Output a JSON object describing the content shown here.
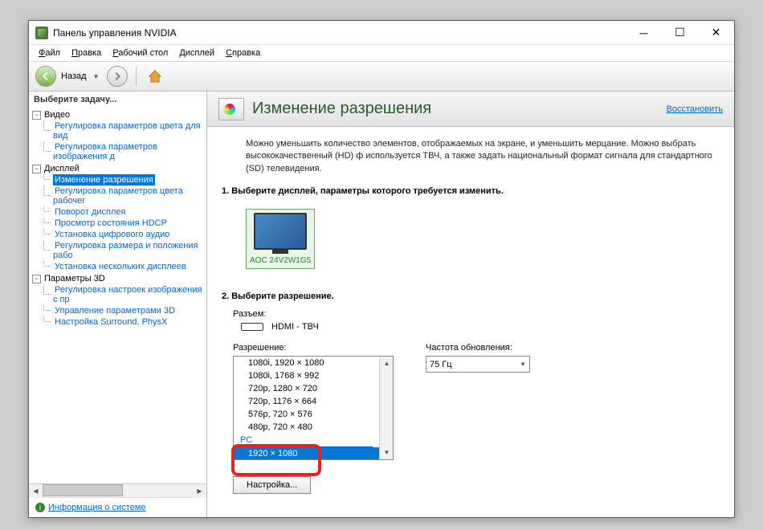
{
  "window": {
    "title": "Панель управления NVIDIA"
  },
  "menu": {
    "file": "Файл",
    "edit": "Правка",
    "desktop": "Рабочий стол",
    "display": "Дисплей",
    "help": "Справка"
  },
  "toolbar": {
    "back": "Назад"
  },
  "sidebar": {
    "task_label": "Выберите задачу...",
    "groups": [
      {
        "label": "Видео",
        "items": [
          {
            "label": "Регулировка параметров цвета для вид"
          },
          {
            "label": "Регулировка параметров изображения д"
          }
        ]
      },
      {
        "label": "Дисплей",
        "items": [
          {
            "label": "Изменение разрешения",
            "selected": true
          },
          {
            "label": "Регулировка параметров цвета рабочег"
          },
          {
            "label": "Поворот дисплея"
          },
          {
            "label": "Просмотр состояния HDCP"
          },
          {
            "label": "Установка цифрового аудио"
          },
          {
            "label": "Регулировка размера и положения рабо"
          },
          {
            "label": "Установка нескольких дисплеев"
          }
        ]
      },
      {
        "label": "Параметры 3D",
        "items": [
          {
            "label": "Регулировка настроек изображения с пр"
          },
          {
            "label": "Управление параметрами 3D"
          },
          {
            "label": "Настройка Surround, PhysX"
          }
        ]
      }
    ],
    "sysinfo": "Информация о системе"
  },
  "content": {
    "title": "Изменение разрешения",
    "restore": "Восстановить",
    "description": "Можно уменьшить количество элементов, отображаемых на экране, и уменьшить мерцание. Можно выбрать высококачественный (HD) ф используется ТВЧ, а также задать национальный формат сигнала для стандартного (SD) телевидения.",
    "step1": "1. Выберите дисплей, параметры которого требуется изменить.",
    "monitor": "AOC 24V2W1G5",
    "step2": "2. Выберите разрешение.",
    "connector_label": "Разъем:",
    "connector_value": "HDMI - ТВЧ",
    "resolution_label": "Разрешение:",
    "resolutions": [
      {
        "text": "1080i, 1920 × 1080"
      },
      {
        "text": "1080i, 1768 × 992"
      },
      {
        "text": "720p, 1280 × 720"
      },
      {
        "text": "720p, 1176 × 664"
      },
      {
        "text": "576p, 720 × 576"
      },
      {
        "text": "480p, 720 × 480"
      }
    ],
    "res_category": "PC",
    "res_selected": "1920 × 1080",
    "refresh_label": "Частота обновления:",
    "refresh_value": "75 Гц",
    "settings_btn": "Настройка..."
  }
}
